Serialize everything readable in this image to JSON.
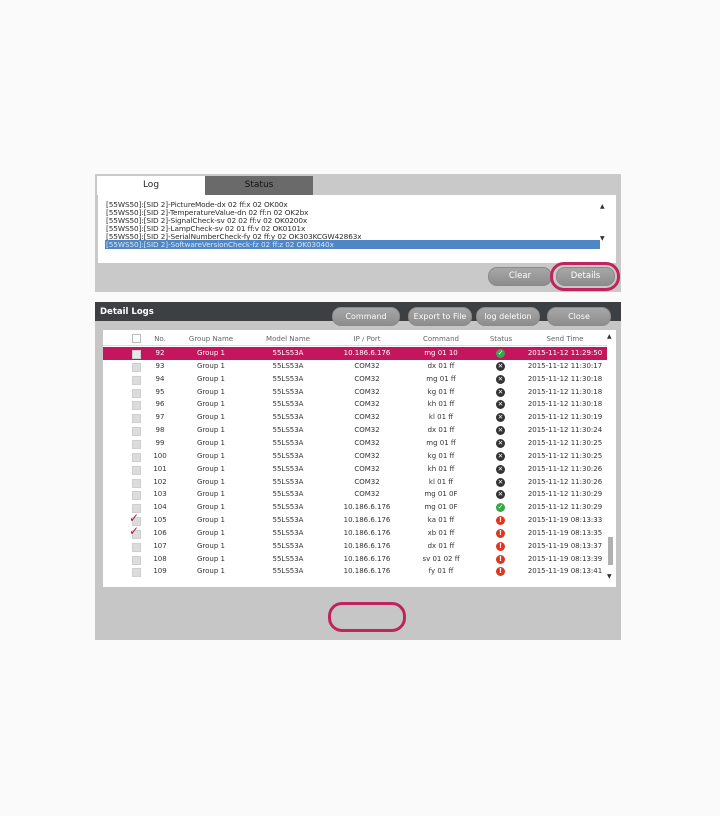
{
  "tabs": [
    {
      "label": "Log",
      "active": true
    },
    {
      "label": "Status",
      "active": false
    }
  ],
  "log": {
    "lines": [
      "[55WS50]:[SID 2]-PictureMode-dx 02 ff:x 02 OK00x",
      "[55WS50]:[SID 2]-TemperatureValue-dn 02 ff:n 02 OK2bx",
      "[55WS50]:[SID 2]-SignalCheck-sv 02 02 ff:v 02 OK0200x",
      "[55WS50]:[SID 2]-LampCheck-sv 02 01 ff:v 02 OK0101x",
      "[55WS50]:[SID 2]-SerialNumberCheck-fy 02 ff:y 02 OK303KCGW42863x",
      "[55WS50]:[SID 2]-SoftwareVersionCheck-fz 02 ff:z 02 OK03040x"
    ],
    "selected_index": 5,
    "clear_label": "Clear",
    "details_label": "Details"
  },
  "detail": {
    "title": "Detail Logs",
    "columns": [
      "No.",
      "Group Name",
      "Model Name",
      "IP / Port",
      "Command",
      "Status",
      "Send Time"
    ],
    "rows": [
      {
        "no": "92",
        "group": "Group 1",
        "model": "55LS53A",
        "port": "10.186.6.176",
        "command": "mg 01 10",
        "status": "ok",
        "time": "2015-11-12 11:29:50",
        "selected": true,
        "checked": false
      },
      {
        "no": "93",
        "group": "Group 1",
        "model": "55LS53A",
        "port": "COM32",
        "command": "dx 01 ff",
        "status": "fail",
        "time": "2015-11-12 11:30:17",
        "selected": false,
        "checked": false
      },
      {
        "no": "94",
        "group": "Group 1",
        "model": "55LS53A",
        "port": "COM32",
        "command": "mg 01 ff",
        "status": "fail",
        "time": "2015-11-12 11:30:18",
        "selected": false,
        "checked": false
      },
      {
        "no": "95",
        "group": "Group 1",
        "model": "55LS53A",
        "port": "COM32",
        "command": "kg 01 ff",
        "status": "fail",
        "time": "2015-11-12 11:30:18",
        "selected": false,
        "checked": false
      },
      {
        "no": "96",
        "group": "Group 1",
        "model": "55LS53A",
        "port": "COM32",
        "command": "kh 01 ff",
        "status": "fail",
        "time": "2015-11-12 11:30:18",
        "selected": false,
        "checked": false
      },
      {
        "no": "97",
        "group": "Group 1",
        "model": "55LS53A",
        "port": "COM32",
        "command": "kl 01 ff",
        "status": "fail",
        "time": "2015-11-12 11:30:19",
        "selected": false,
        "checked": false
      },
      {
        "no": "98",
        "group": "Group 1",
        "model": "55LS53A",
        "port": "COM32",
        "command": "dx 01 ff",
        "status": "fail",
        "time": "2015-11-12 11:30:24",
        "selected": false,
        "checked": false
      },
      {
        "no": "99",
        "group": "Group 1",
        "model": "55LS53A",
        "port": "COM32",
        "command": "mg 01 ff",
        "status": "fail",
        "time": "2015-11-12 11:30:25",
        "selected": false,
        "checked": false
      },
      {
        "no": "100",
        "group": "Group 1",
        "model": "55LS53A",
        "port": "COM32",
        "command": "kg 01 ff",
        "status": "fail",
        "time": "2015-11-12 11:30:25",
        "selected": false,
        "checked": false
      },
      {
        "no": "101",
        "group": "Group 1",
        "model": "55LS53A",
        "port": "COM32",
        "command": "kh 01 ff",
        "status": "fail",
        "time": "2015-11-12 11:30:26",
        "selected": false,
        "checked": false
      },
      {
        "no": "102",
        "group": "Group 1",
        "model": "55LS53A",
        "port": "COM32",
        "command": "kl 01 ff",
        "status": "fail",
        "time": "2015-11-12 11:30:26",
        "selected": false,
        "checked": false
      },
      {
        "no": "103",
        "group": "Group 1",
        "model": "55LS53A",
        "port": "COM32",
        "command": "mg 01 0F",
        "status": "fail",
        "time": "2015-11-12 11:30:29",
        "selected": false,
        "checked": false
      },
      {
        "no": "104",
        "group": "Group 1",
        "model": "55LS53A",
        "port": "10.186.6.176",
        "command": "mg 01 0F",
        "status": "ok",
        "time": "2015-11-12 11:30:29",
        "selected": false,
        "checked": false
      },
      {
        "no": "105",
        "group": "Group 1",
        "model": "55LS53A",
        "port": "10.186.6.176",
        "command": "ka 01 ff",
        "status": "warn",
        "time": "2015-11-19 08:13:33",
        "selected": false,
        "checked": true
      },
      {
        "no": "106",
        "group": "Group 1",
        "model": "55LS53A",
        "port": "10.186.6.176",
        "command": "xb 01 ff",
        "status": "warn",
        "time": "2015-11-19 08:13:35",
        "selected": false,
        "checked": true
      },
      {
        "no": "107",
        "group": "Group 1",
        "model": "55LS53A",
        "port": "10.186.6.176",
        "command": "dx 01 ff",
        "status": "warn",
        "time": "2015-11-19 08:13:37",
        "selected": false,
        "checked": false
      },
      {
        "no": "108",
        "group": "Group 1",
        "model": "55LS53A",
        "port": "10.186.6.176",
        "command": "sv 01 02 ff",
        "status": "warn",
        "time": "2015-11-19 08:13:39",
        "selected": false,
        "checked": false
      },
      {
        "no": "109",
        "group": "Group 1",
        "model": "55LS53A",
        "port": "10.186.6.176",
        "command": "fy 01 ff",
        "status": "warn",
        "time": "2015-11-19 08:13:41",
        "selected": false,
        "checked": false
      }
    ],
    "buttons": {
      "command_again": "Command Again",
      "export": "Export to File",
      "delete": "log deletion",
      "close": "Close"
    }
  },
  "colors": {
    "accent": "#c4165d",
    "highlight_ring": "#c0245c",
    "log_selection": "#4f86c6",
    "status_ok": "#35a94a",
    "status_fail": "#333333",
    "status_warn": "#e0341f"
  },
  "icons": {
    "status_ok": "check-circle-icon",
    "status_fail": "x-circle-icon",
    "status_warn": "exclamation-circle-icon",
    "row_checked": "checkmark-icon"
  }
}
